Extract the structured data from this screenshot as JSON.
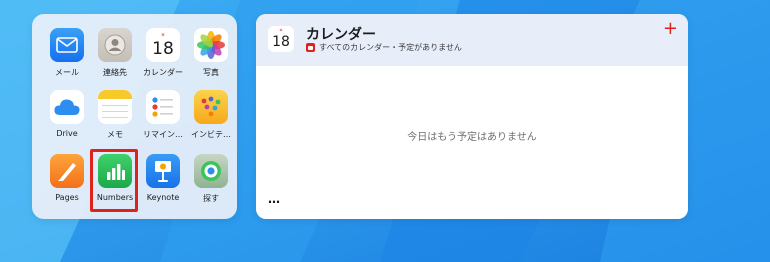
{
  "apps": [
    {
      "name": "メール",
      "icon": "mail-icon"
    },
    {
      "name": "連絡先",
      "icon": "contacts-icon"
    },
    {
      "name": "カレンダー",
      "icon": "calendar-icon",
      "day": "18"
    },
    {
      "name": "写真",
      "icon": "photos-icon"
    },
    {
      "name": "Drive",
      "icon": "icloud-drive-icon"
    },
    {
      "name": "メモ",
      "icon": "notes-icon"
    },
    {
      "name": "リマイン…",
      "icon": "reminders-icon"
    },
    {
      "name": "インビテ…",
      "icon": "invites-icon"
    },
    {
      "name": "Pages",
      "icon": "pages-icon"
    },
    {
      "name": "Numbers",
      "icon": "numbers-icon"
    },
    {
      "name": "Keynote",
      "icon": "keynote-icon"
    },
    {
      "name": "探す",
      "icon": "find-my-icon"
    }
  ],
  "calendar_widget": {
    "icon_day": "18",
    "title": "カレンダー",
    "subtitle": "すべてのカレンダー・予定がありません",
    "add_label": "+",
    "empty_message": "今日はもう予定はありません",
    "more_label": "…"
  },
  "colors": {
    "accent_red": "#e0221c",
    "background_blue": "#1f8de8"
  }
}
